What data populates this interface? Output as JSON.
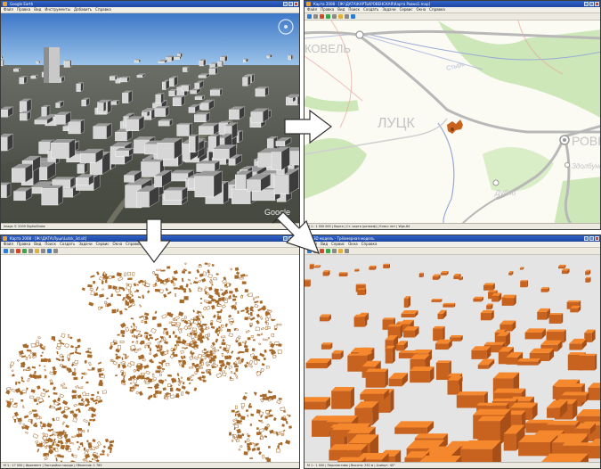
{
  "panel1": {
    "title": "Google Earth",
    "menus": [
      "Файл",
      "Правка",
      "Вид",
      "Инструменты",
      "Добавить",
      "Справка"
    ],
    "watermark": "Google",
    "status": "Image © 2009 DigitalGlobe"
  },
  "panel2": {
    "title": "Карта 2008 - [Ж:\\ДАТА\\КАРТЫ\\РОВЕНСКАЯ\\Карта Ровно1.map]",
    "menus": [
      "Файл",
      "Правка",
      "Вид",
      "Поиск",
      "Создать",
      "Задачи",
      "Сервис",
      "Окна",
      "Справка"
    ],
    "labels": {
      "kovel": "КОВЕЛЬ",
      "lutsk": "ЛУЦК",
      "rivne": "РОВНО",
      "dubno": "Дубно",
      "zdolbuniv": "Здолбунов",
      "styr": "Стырь"
    },
    "status": "М 1 : 1 500 000   |  Карта  |  Ст. карта (рельеф)  |  Ключ: нет  |  Wgs-84"
  },
  "panel3": {
    "title": "Карта 2008 - [Ж:\\ДАТА\\Луцк\\Lutsk_3d.sit]",
    "menus": [
      "Файл",
      "Правка",
      "Вид",
      "Поиск",
      "Создать",
      "Задачи",
      "Сервис",
      "Окна",
      "Справка"
    ],
    "status": "М 1 : 17 000   |  Фрагмент  |  Застройка города  |  Объектов: 1 785"
  },
  "panel4": {
    "title": "3D модель - Трёхмерная модель",
    "menus": [
      "Файл",
      "Вид",
      "Сервис",
      "Окна",
      "Справка"
    ],
    "status": "М 1 : 1 000   |  Перспектива  |  Высота: 250 м  |  Азимут: 45°"
  },
  "colors": {
    "building": "#a86a2a",
    "orange_roof": "#f5872d",
    "orange_wall": "#c8621f",
    "arrow_fill": "#ffffff"
  }
}
